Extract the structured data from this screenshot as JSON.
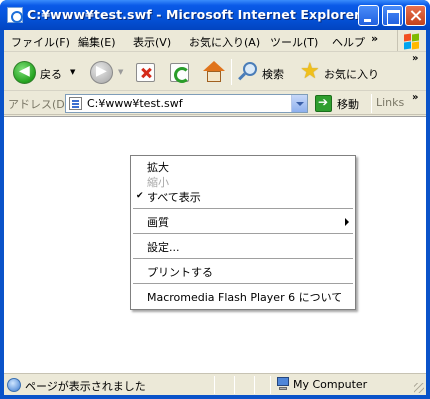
{
  "window": {
    "title": "C:¥www¥test.swf - Microsoft Internet Explorer"
  },
  "menubar": {
    "items": [
      {
        "label": "ファイル(F)"
      },
      {
        "label": "編集(E)"
      },
      {
        "label": "表示(V)"
      },
      {
        "label": "お気に入り(A)"
      },
      {
        "label": "ツール(T)"
      },
      {
        "label": "ヘルプ"
      }
    ],
    "more": "»"
  },
  "toolbar": {
    "back_label": "戻る",
    "search_label": "検索",
    "favorites_label": "お気に入り",
    "more": "»"
  },
  "address": {
    "label": "アドレス(D)",
    "value": "C:¥www¥test.swf",
    "go_label": "移動",
    "links_label": "Links",
    "more": "»"
  },
  "context_menu": {
    "items": [
      {
        "label": "拡大",
        "enabled": true,
        "checked": false
      },
      {
        "label": "縮小",
        "enabled": false,
        "checked": false
      },
      {
        "label": "すべて表示",
        "enabled": true,
        "checked": true
      },
      {
        "label": "画質",
        "enabled": true,
        "submenu": true
      },
      {
        "label": "設定...",
        "enabled": true
      },
      {
        "label": "プリントする",
        "enabled": true
      },
      {
        "label": "Macromedia Flash Player 6 について",
        "enabled": true
      }
    ],
    "check_glyph": "✔"
  },
  "statusbar": {
    "text": "ページが表示されました",
    "zone": "My Computer"
  },
  "colors": {
    "titlebar": "#0a5ae8",
    "chrome": "#ece9d8",
    "content": "#ffffff"
  },
  "icons": [
    "ie-page-icon",
    "minimize-icon",
    "maximize-icon",
    "close-icon",
    "windows-logo-icon",
    "back-arrow-icon",
    "forward-arrow-icon",
    "stop-icon",
    "refresh-icon",
    "home-icon",
    "search-icon",
    "favorites-star-icon",
    "address-page-icon",
    "go-arrow-icon",
    "status-globe-icon",
    "my-computer-icon"
  ]
}
